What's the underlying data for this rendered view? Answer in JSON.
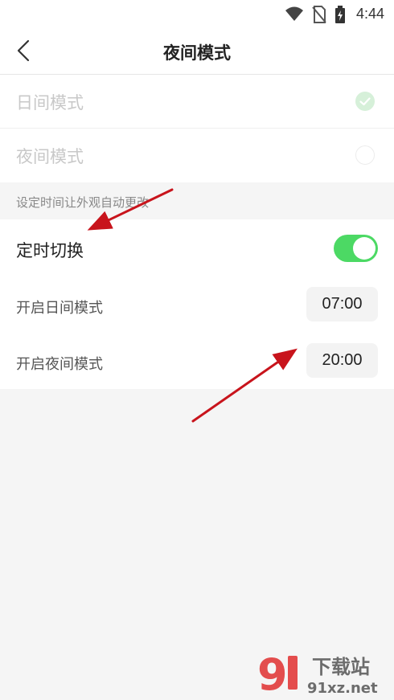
{
  "status_bar": {
    "time": "4:44",
    "icons": [
      "wifi-icon",
      "no-sim-icon",
      "battery-charging-icon"
    ]
  },
  "header": {
    "back_icon": "chevron-left-icon",
    "title": "夜间模式"
  },
  "appearance_modes": [
    {
      "label": "日间模式",
      "selected": true
    },
    {
      "label": "夜间模式",
      "selected": false
    }
  ],
  "section_caption": "设定时间让外观自动更改",
  "timer": {
    "label": "定时切换",
    "enabled": true,
    "day_mode": {
      "label": "开启日间模式",
      "time": "07:00"
    },
    "night_mode": {
      "label": "开启夜间模式",
      "time": "20:00"
    }
  },
  "colors": {
    "toggle_on": "#4cd964",
    "annotation_arrow": "#d0141c",
    "watermark_red": "#e23b3b"
  },
  "watermark": {
    "logo_text": "9",
    "brand_name": "下载站",
    "domain": "91xz.net"
  }
}
